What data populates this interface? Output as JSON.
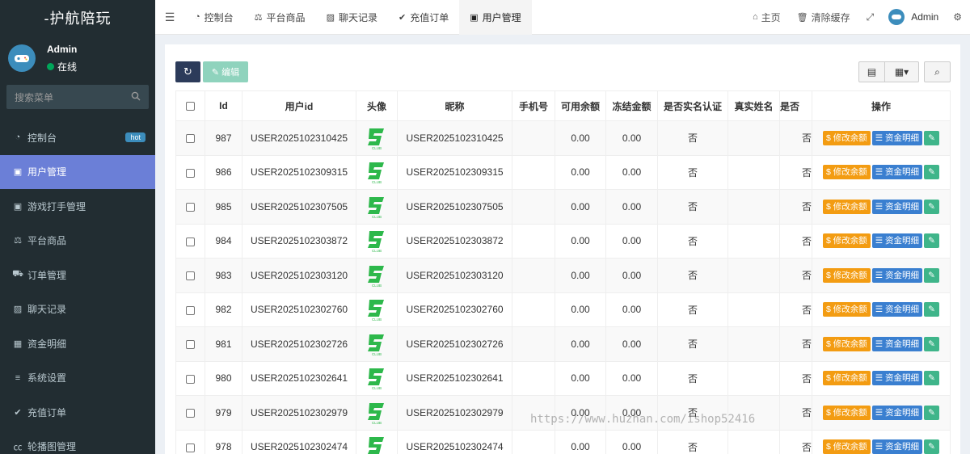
{
  "sidebar": {
    "logo": "-护航陪玩",
    "user_name": "Admin",
    "user_status": "在线",
    "search_placeholder": "搜索菜单",
    "items": [
      {
        "label": "控制台",
        "icon": "dashboard-icon",
        "badge": "hot"
      },
      {
        "label": "用户管理",
        "icon": "user-icon",
        "active": true
      },
      {
        "label": "游戏打手管理",
        "icon": "user-icon"
      },
      {
        "label": "平台商品",
        "icon": "balance-icon"
      },
      {
        "label": "订单管理",
        "icon": "cart-icon"
      },
      {
        "label": "聊天记录",
        "icon": "image-icon"
      },
      {
        "label": "资金明细",
        "icon": "calendar-icon"
      },
      {
        "label": "系统设置",
        "icon": "list-icon"
      },
      {
        "label": "充值订单",
        "icon": "check-icon"
      },
      {
        "label": "轮播图管理",
        "icon": "cc-icon"
      }
    ]
  },
  "header": {
    "tabs": [
      {
        "label": "控制台",
        "icon": "dashboard-icon"
      },
      {
        "label": "平台商品",
        "icon": "balance-icon"
      },
      {
        "label": "聊天记录",
        "icon": "image-icon"
      },
      {
        "label": "充值订单",
        "icon": "check-icon"
      },
      {
        "label": "用户管理",
        "icon": "user-icon",
        "active": true
      }
    ],
    "home": "主页",
    "clear_cache": "清除缓存",
    "admin": "Admin"
  },
  "toolbar": {
    "edit_label": "编辑"
  },
  "table": {
    "columns": [
      "Id",
      "用户id",
      "头像",
      "昵称",
      "手机号",
      "可用余额",
      "冻结金额",
      "是否实名认证",
      "真实姓名",
      "是否",
      "操作"
    ],
    "rows": [
      {
        "id": "987",
        "user_id": "USER2025102310425",
        "nickname": "USER2025102310425",
        "phone": "",
        "balance": "0.00",
        "frozen": "0.00",
        "verified": "否",
        "real_name": "",
        "flag": "否"
      },
      {
        "id": "986",
        "user_id": "USER2025102309315",
        "nickname": "USER2025102309315",
        "phone": "",
        "balance": "0.00",
        "frozen": "0.00",
        "verified": "否",
        "real_name": "",
        "flag": "否"
      },
      {
        "id": "985",
        "user_id": "USER2025102307505",
        "nickname": "USER2025102307505",
        "phone": "",
        "balance": "0.00",
        "frozen": "0.00",
        "verified": "否",
        "real_name": "",
        "flag": "否"
      },
      {
        "id": "984",
        "user_id": "USER2025102303872",
        "nickname": "USER2025102303872",
        "phone": "",
        "balance": "0.00",
        "frozen": "0.00",
        "verified": "否",
        "real_name": "",
        "flag": "否"
      },
      {
        "id": "983",
        "user_id": "USER2025102303120",
        "nickname": "USER2025102303120",
        "phone": "",
        "balance": "0.00",
        "frozen": "0.00",
        "verified": "否",
        "real_name": "",
        "flag": "否"
      },
      {
        "id": "982",
        "user_id": "USER2025102302760",
        "nickname": "USER2025102302760",
        "phone": "",
        "balance": "0.00",
        "frozen": "0.00",
        "verified": "否",
        "real_name": "",
        "flag": "否"
      },
      {
        "id": "981",
        "user_id": "USER2025102302726",
        "nickname": "USER2025102302726",
        "phone": "",
        "balance": "0.00",
        "frozen": "0.00",
        "verified": "否",
        "real_name": "",
        "flag": "否"
      },
      {
        "id": "980",
        "user_id": "USER2025102302641",
        "nickname": "USER2025102302641",
        "phone": "",
        "balance": "0.00",
        "frozen": "0.00",
        "verified": "否",
        "real_name": "",
        "flag": "否"
      },
      {
        "id": "979",
        "user_id": "USER2025102302979",
        "nickname": "USER2025102302979",
        "phone": "",
        "balance": "0.00",
        "frozen": "0.00",
        "verified": "否",
        "real_name": "",
        "flag": "否"
      },
      {
        "id": "978",
        "user_id": "USER2025102302474",
        "nickname": "USER2025102302474",
        "phone": "",
        "balance": "0.00",
        "frozen": "0.00",
        "verified": "否",
        "real_name": "",
        "flag": "否"
      }
    ],
    "actions": {
      "modify_balance": "修改余额",
      "fund_detail": "资金明细"
    }
  },
  "watermark": "https://www.huzhan.com/ishop52416",
  "colors": {
    "sidebar_bg": "#222d32",
    "active_item": "#6b7fd7",
    "orange": "#f39c12",
    "blue": "#3a7fd0",
    "green": "#3fb58a",
    "refresh_btn": "#2c3b5a"
  }
}
